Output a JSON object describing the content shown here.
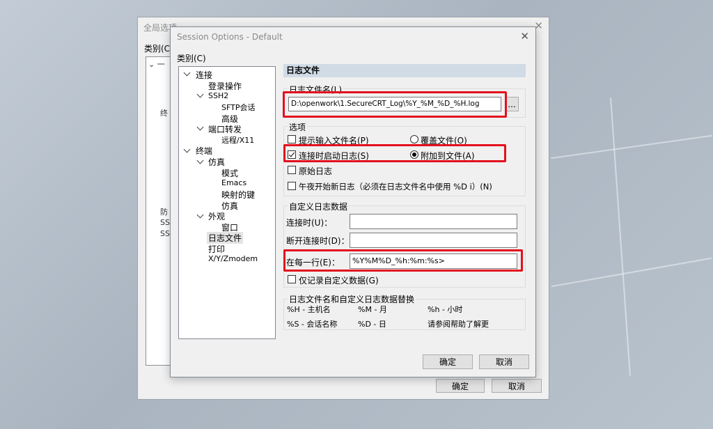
{
  "back_dialog": {
    "title": "全局选项",
    "category_label": "类别(C)",
    "tree_fragments": [
      "一",
      "终",
      "防",
      "SS",
      "SS"
    ],
    "ok": "确定",
    "cancel": "取消"
  },
  "dialog": {
    "title": "Session Options - Default",
    "category_label": "类别(C)",
    "ok": "确定",
    "cancel": "取消"
  },
  "tree": [
    {
      "label": "连接"
    },
    {
      "label": "登录操作"
    },
    {
      "label": "SSH2"
    },
    {
      "label": "SFTP会话"
    },
    {
      "label": "高级"
    },
    {
      "label": "端口转发"
    },
    {
      "label": "远程/X11"
    },
    {
      "label": "终端"
    },
    {
      "label": "仿真"
    },
    {
      "label": "模式"
    },
    {
      "label": "Emacs"
    },
    {
      "label": "映射的键"
    },
    {
      "label": "仿真"
    },
    {
      "label": "外观"
    },
    {
      "label": "窗口"
    },
    {
      "label": "日志文件"
    },
    {
      "label": "打印"
    },
    {
      "label": "X/Y/Zmodem"
    }
  ],
  "panel": {
    "header": "日志文件",
    "log_filename_label": "日志文件名(L)",
    "log_filename_value": "D:\\openwork\\1.SecureCRT_Log\\%Y_%M_%D_%H.log",
    "browse_label": "...",
    "options_title": "选项",
    "options": {
      "prompt_filename": "提示输入文件名(P)",
      "overwrite": "覆盖文件(O)",
      "start_on_connect": "连接时启动日志(S)",
      "append": "附加到文件(A)",
      "raw_log": "原始日志",
      "new_log_midnight": "午夜开始新日志（必须在日志文件名中使用 %D i）(N)"
    },
    "custom_title": "自定义日志数据",
    "on_connect_label": "连接时(U)：",
    "on_disconnect_label": "断开连接时(D)：",
    "each_line_label": "在每一行(E)：",
    "each_line_value": "%Y%M%D_%h:%m:%s>",
    "only_custom_label": "仅记录自定义数据(G)",
    "subst_title": "日志文件名和自定义日志数据替换",
    "subst": [
      [
        "%H - 主机名",
        "%M - 月",
        "%h - 小时"
      ],
      [
        "%S - 会话名称",
        "%D - 日",
        "请参阅帮助了解更"
      ]
    ]
  },
  "state": {
    "prompt_filename": false,
    "overwrite": false,
    "start_on_connect": true,
    "append": true,
    "raw_log": false,
    "new_log_midnight": false,
    "only_custom": false
  },
  "colors": {
    "highlight_box": "#e3101e",
    "header_bar": "#d0dbe6"
  }
}
